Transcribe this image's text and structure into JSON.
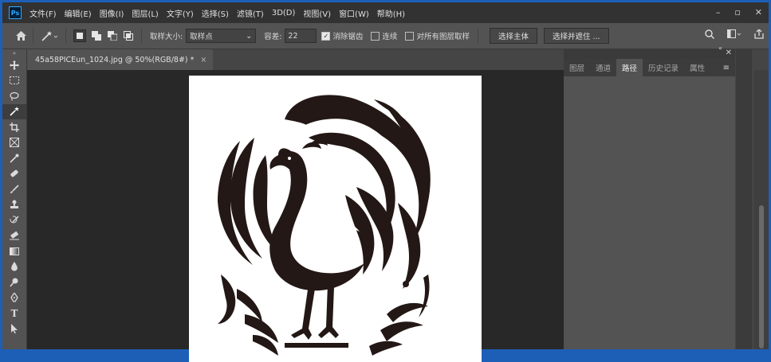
{
  "menubar": {
    "logo": "Ps",
    "items": [
      "文件(F)",
      "编辑(E)",
      "图像(I)",
      "图层(L)",
      "文字(Y)",
      "选择(S)",
      "滤镜(T)",
      "3D(D)",
      "视图(V)",
      "窗口(W)",
      "帮助(H)"
    ],
    "window_controls": [
      "minimize-icon",
      "restore-icon",
      "close-icon"
    ]
  },
  "options": {
    "sample_size_label": "取样大小:",
    "sample_size_value": "取样点",
    "tolerance_label": "容差:",
    "tolerance_value": "22",
    "antialias_label": "消除锯齿",
    "antialias_checked": true,
    "contiguous_label": "连续",
    "contiguous_checked": false,
    "all_layers_label": "对所有图层取样",
    "all_layers_checked": false,
    "select_subject": "选择主体",
    "select_and_mask": "选择并遮住 ..."
  },
  "document": {
    "tab_title": "45a58PICEun_1024.jpg @ 50%(RGB/8#) *",
    "close_glyph": "×"
  },
  "panel": {
    "tabs": [
      "图层",
      "通道",
      "路径",
      "历史记录",
      "属性"
    ],
    "active_tab": 2
  },
  "colors": {
    "accent": "#31a8ff",
    "background": "#535353",
    "canvas_bg": "#282828"
  }
}
